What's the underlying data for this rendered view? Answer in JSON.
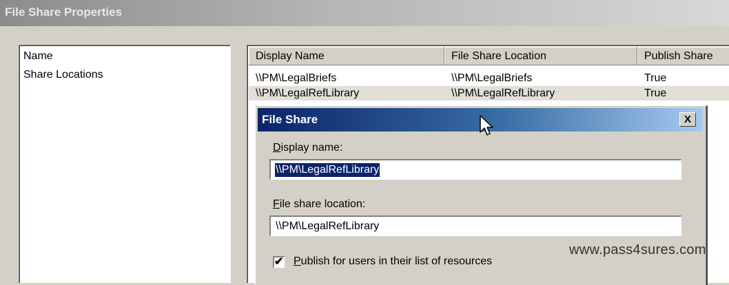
{
  "window": {
    "title": "File Share Properties"
  },
  "left_list": {
    "items": [
      "Name",
      "Share Locations"
    ]
  },
  "table": {
    "columns": [
      "Display Name",
      "File Share Location",
      "Publish Share"
    ],
    "rows": [
      [
        "\\\\PM\\LegalBriefs",
        "\\\\PM\\LegalBriefs",
        "True"
      ],
      [
        "\\\\PM\\LegalRefLibrary",
        "\\\\PM\\LegalRefLibrary",
        "True"
      ]
    ]
  },
  "dialog": {
    "title": "File Share",
    "close_glyph": "X",
    "display_name": {
      "label_accel": "D",
      "label_rest": "isplay name:",
      "value": "\\\\PM\\LegalRefLibrary"
    },
    "location": {
      "label_accel": "F",
      "label_rest": "ile share location:",
      "value": "\\\\PM\\LegalRefLibrary"
    },
    "publish": {
      "checked": true,
      "check_glyph": "✔",
      "label_accel": "P",
      "label_rest": "ublish for users in their list of resources"
    }
  },
  "watermark": "www.pass4sures.com"
}
